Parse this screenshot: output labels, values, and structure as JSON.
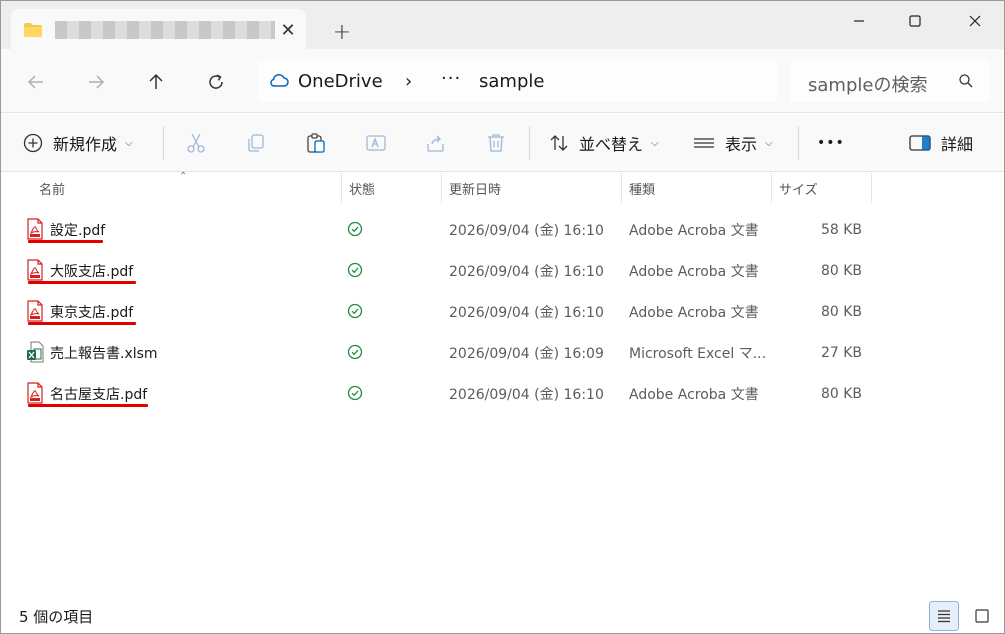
{
  "window": {
    "tab_title": "██████████████",
    "tab_close": "✕",
    "new_tab": "+"
  },
  "address_bar": {
    "location": "OneDrive",
    "separator": "›",
    "more": "···",
    "current_folder": "sample"
  },
  "search": {
    "placeholder": "sampleの検索"
  },
  "command_bar": {
    "new_label": "新規作成",
    "sort_label": "並べ替え",
    "view_label": "表示",
    "more_label": "•••",
    "details_label": "詳細"
  },
  "columns": {
    "name": "名前",
    "status": "状態",
    "modified": "更新日時",
    "type": "種類",
    "size": "サイズ"
  },
  "files": [
    {
      "name": "設定.pdf",
      "modified": "2026/09/04 (金) 16:10",
      "type": "Adobe Acroba 文書",
      "size": "58 KB",
      "icon": "pdf-icon",
      "underlined": true
    },
    {
      "name": "大阪支店.pdf",
      "modified": "2026/09/04 (金) 16:10",
      "type": "Adobe Acroba 文書",
      "size": "80 KB",
      "icon": "pdf-icon",
      "underlined": true
    },
    {
      "name": "東京支店.pdf",
      "modified": "2026/09/04 (金) 16:10",
      "type": "Adobe Acroba 文書",
      "size": "80 KB",
      "icon": "pdf-icon",
      "underlined": true
    },
    {
      "name": "売上報告書.xlsm",
      "modified": "2026/09/04 (金) 16:09",
      "type": "Microsoft Excel マ...",
      "size": "27 KB",
      "icon": "excel-icon",
      "underlined": false
    },
    {
      "name": "名古屋支店.pdf",
      "modified": "2026/09/04 (金) 16:10",
      "type": "Adobe Acroba 文書",
      "size": "80 KB",
      "icon": "pdf-icon",
      "underlined": true
    }
  ],
  "status_bar": {
    "item_count": "5 個の項目"
  },
  "colors": {
    "accent": "#0067c0",
    "sync_ok": "#1f8a3b",
    "pdf_red": "#d42020",
    "excel_green": "#1d7044",
    "annotation_underline": "#e00000"
  }
}
